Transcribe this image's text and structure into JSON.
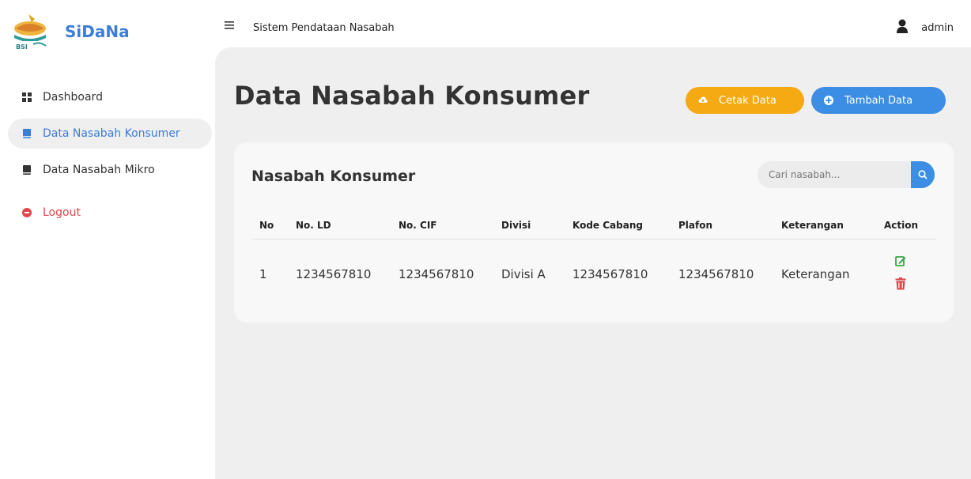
{
  "brand": {
    "name": "SiDaNa",
    "logo_text": "BSI"
  },
  "header": {
    "menu_icon": "hamburger-icon",
    "app_title": "Sistem Pendataan Nasabah",
    "user_icon": "user-icon",
    "user_name": "admin"
  },
  "sidebar": {
    "items": [
      {
        "label": "Dashboard",
        "icon": "grid-icon"
      },
      {
        "label": "Data Nasabah Konsumer",
        "icon": "book-icon",
        "active": true
      },
      {
        "label": "Data Nasabah Mikro",
        "icon": "book-icon"
      },
      {
        "label": "Logout",
        "icon": "logout-icon"
      }
    ]
  },
  "main": {
    "title": "Data Nasabah Konsumer",
    "buttons": {
      "cetak": "Cetak Data",
      "tambah": "Tambah Data"
    }
  },
  "card": {
    "title": "Nasabah Konsumer",
    "search_placeholder": "Cari nasabah...",
    "columns": [
      "No",
      "No. LD",
      "No. CIF",
      "Divisi",
      "Kode Cabang",
      "Plafon",
      "Keterangan",
      "Action"
    ],
    "rows": [
      {
        "no": "1",
        "no_ld": "1234567810",
        "no_cif": "1234567810",
        "divisi": "Divisi A",
        "kode_cabang": "1234567810",
        "plafon": "1234567810",
        "keterangan": "Keterangan"
      }
    ]
  },
  "colors": {
    "primary": "#3b8ee3",
    "warning": "#f5a913",
    "danger": "#e0454a",
    "success": "#3aa845",
    "background": "#efefef"
  }
}
